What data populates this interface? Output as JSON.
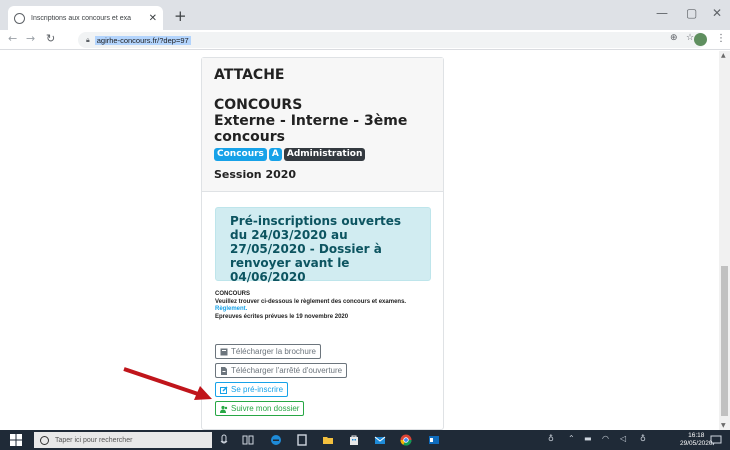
{
  "browser": {
    "tab_title": "Inscriptions aux concours et exa",
    "url": "agirhe-concours.fr/?dep=97"
  },
  "page": {
    "title": "ATTACHE",
    "concours_label": "CONCOURS",
    "concours_types": "Externe - Interne - 3ème concours",
    "badges": [
      "Concours",
      "A",
      "Administration"
    ],
    "session": "Session 2020",
    "alert": "Pré-inscriptions ouvertes du 24/03/2020 au 27/05/2020 - Dossier à renvoyer avant le 04/06/2020",
    "info": {
      "heading": "CONCOURS",
      "text": "Veuillez trouver ci-dessous le règlement des concours et examens.",
      "link": "Règlement.",
      "epreuves": "Epreuves écrites prévues le 19 novembre 2020"
    },
    "buttons": {
      "brochure": "Télécharger la brochure",
      "arrete": "Télécharger l'arrêté d'ouverture",
      "preinscrire": "Se pré-inscrire",
      "dossier": "Suivre mon dossier"
    }
  },
  "taskbar": {
    "search_placeholder": "Taper ici pour rechercher",
    "time": "16:18",
    "date": "29/05/2020"
  },
  "colors": {
    "accent_blue": "#17a2e8",
    "alert_bg": "#d1ecf1",
    "green": "#28a745",
    "arrow_red": "#c0151b"
  }
}
